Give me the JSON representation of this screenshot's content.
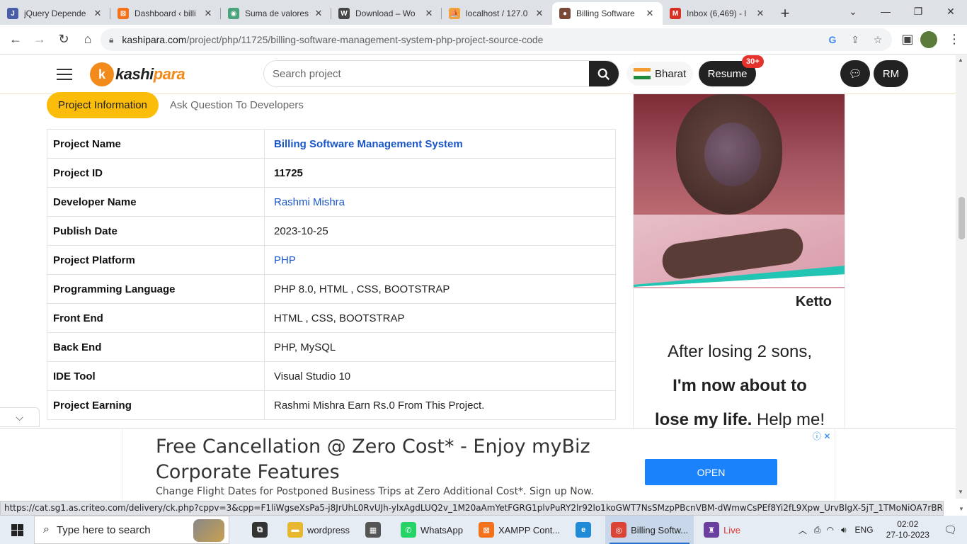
{
  "browser": {
    "tabs": [
      {
        "title": "jQuery Depende",
        "fav_color": "#4a5ea8",
        "fav_char": "J"
      },
      {
        "title": "Dashboard ‹ billi",
        "fav_color": "#f3721b",
        "fav_char": "⊠"
      },
      {
        "title": "Suma de valores",
        "fav_color": "#4aa37c",
        "fav_char": "◉"
      },
      {
        "title": "Download – Wo",
        "fav_color": "#464646",
        "fav_char": "W"
      },
      {
        "title": "localhost / 127.0",
        "fav_color": "#f3a03a",
        "fav_char": "⛵"
      },
      {
        "title": "Billing Software",
        "fav_color": "#7a4a38",
        "fav_char": "●",
        "active": true
      },
      {
        "title": "Inbox (6,469) - l",
        "fav_color": "#d93025",
        "fav_char": "M"
      }
    ],
    "url_host": "kashipara.com",
    "url_path": "/project/php/11725/billing-software-management-system-php-project-source-code"
  },
  "header": {
    "logo_text_a": "kashi",
    "logo_text_b": "para",
    "search_placeholder": "Search project",
    "country": "Bharat",
    "resume_label": "Resume",
    "resume_badge": "30+",
    "user_initials": "RM"
  },
  "section_tabs": {
    "active": "Project Information",
    "other": "Ask Question To Developers"
  },
  "project_info": [
    {
      "key": "Project Name",
      "value": "Billing Software Management System",
      "style": "bluebold"
    },
    {
      "key": "Project ID",
      "value": "11725",
      "style": "bold"
    },
    {
      "key": "Developer Name",
      "value": "Rashmi Mishra",
      "style": "blue"
    },
    {
      "key": "Publish Date",
      "value": "2023-10-25",
      "style": ""
    },
    {
      "key": "Project Platform",
      "value": "PHP",
      "style": "blue"
    },
    {
      "key": "Programming Language",
      "value": "PHP 8.0, HTML , CSS, BOOTSTRAP",
      "style": ""
    },
    {
      "key": "Front End",
      "value": "HTML , CSS, BOOTSTRAP",
      "style": ""
    },
    {
      "key": "Back End",
      "value": "PHP, MySQL",
      "style": ""
    },
    {
      "key": "IDE Tool",
      "value": "Visual Studio 10",
      "style": ""
    },
    {
      "key": "Project Earning",
      "value": "Rashmi Mishra Earn Rs.0 From This Project.",
      "style": ""
    }
  ],
  "side_ad": {
    "brand": "Ketto",
    "line1": "After losing 2 sons,",
    "line2": "I'm now about to",
    "line3a": "lose my life.",
    "line3b": " Help me!"
  },
  "bottom_ad": {
    "headline": "Free Cancellation @ Zero Cost* - Enjoy myBiz Corporate Features",
    "subline": "Change Flight Dates for Postponed Business Trips at Zero Additional Cost*. Sign up Now.",
    "cta": "OPEN"
  },
  "status_url": "https://cat.sg1.as.criteo.com/delivery/ck.php?cppv=3&cpp=F1liWgseXsPa5-j8JrUhL0RvUJh-ylxAgdLUQ2v_1M20aAmYetFGRG1plvPuRY2lr92lo1koGWT7NsSMzpPBcnVBM-dWmwCsPEf8Yi2fL9Xpw_UrvBlgX-5jT_1TMoNiOA7rBRIE5_Atq6UDBUF7YnWrT7...",
  "taskbar": {
    "search_placeholder": "Type here to search",
    "items": [
      {
        "label": "",
        "color": "#333",
        "char": "⧉"
      },
      {
        "label": "wordpress",
        "color": "#e8b730",
        "char": "▬"
      },
      {
        "label": "",
        "color": "#555",
        "char": "▦"
      },
      {
        "label": "WhatsApp",
        "color": "#25d366",
        "char": "✆"
      },
      {
        "label": "XAMPP Cont...",
        "color": "#f3721b",
        "char": "⊠"
      },
      {
        "label": "",
        "color": "#1f8bd6",
        "char": "e"
      },
      {
        "label": "Billing Softw...",
        "color": "#db4437",
        "char": "◎",
        "active": true
      },
      {
        "label": "Live",
        "color": "#6b3fa0",
        "char": "♜",
        "label_color": "#e5322d"
      }
    ],
    "lang": "ENG",
    "time": "02:02",
    "date": "27-10-2023"
  }
}
